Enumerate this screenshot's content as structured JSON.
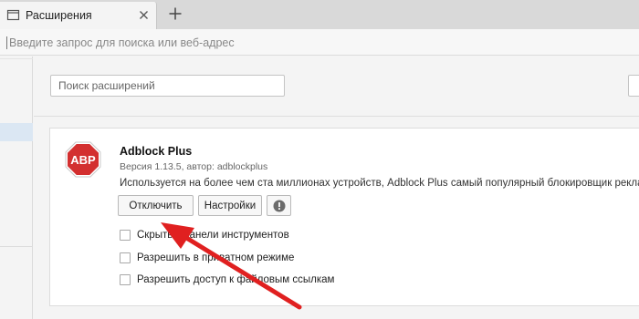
{
  "tab": {
    "title": "Расширения",
    "favicon": "extensions-icon",
    "close": "close-icon"
  },
  "new_tab_icon": "plus-icon",
  "address_bar": {
    "placeholder": "Введите запрос для поиска или веб-адрес",
    "value": ""
  },
  "extensions_page": {
    "search": {
      "placeholder": "Поиск расширений",
      "value": ""
    },
    "extension": {
      "logo_text": "ABP",
      "name": "Adblock Plus",
      "version_line": "Версия 1.13.5, автор: adblockplus",
      "description": "Используется на более чем ста миллионах устройств, Adblock Plus самый популярный блокировщик рекламы.",
      "buttons": {
        "disable": "Отключить",
        "settings": "Настройки",
        "info_icon": "exclamation-icon"
      },
      "options": [
        {
          "label": "Скрыть с панели инструментов",
          "checked": false
        },
        {
          "label": "Разрешить в приватном режиме",
          "checked": false
        },
        {
          "label": "Разрешить доступ к файловым ссылкам",
          "checked": false
        }
      ]
    }
  },
  "colors": {
    "abp_red": "#d32f2f",
    "annotation_arrow": "#e02020",
    "sidebar_active": "#dbe7f3"
  }
}
